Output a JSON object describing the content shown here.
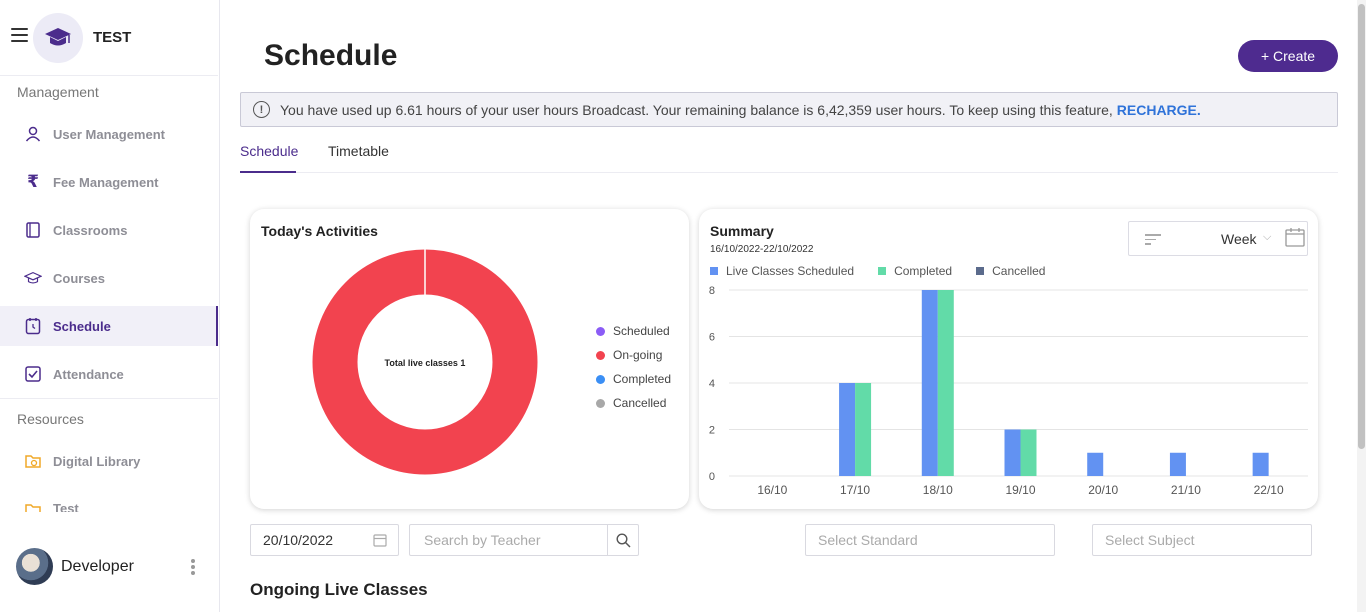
{
  "sidebar": {
    "brand": "TEST",
    "section_management": "Management",
    "section_resources": "Resources",
    "items": [
      {
        "label": "User Management",
        "icon": "user-icon"
      },
      {
        "label": "Fee Management",
        "icon": "rupee-icon"
      },
      {
        "label": "Classrooms",
        "icon": "book-icon"
      },
      {
        "label": "Courses",
        "icon": "graduation-cap-icon"
      },
      {
        "label": "Schedule",
        "icon": "clock-icon",
        "active": true
      },
      {
        "label": "Attendance",
        "icon": "checkbox-icon"
      }
    ],
    "resources": [
      {
        "label": "Digital Library",
        "icon": "library-icon"
      },
      {
        "label": "Test",
        "icon": "test-icon"
      }
    ],
    "user_name": "Developer"
  },
  "header": {
    "title": "Schedule",
    "create_label": "+ Create"
  },
  "alert": {
    "text": "You have used up 6.61 hours of your user hours Broadcast. Your remaining balance is 6,42,359 user hours. To keep using this feature,",
    "link": "RECHARGE."
  },
  "tabs": [
    "Schedule",
    "Timetable"
  ],
  "activities": {
    "title": "Today's Activities",
    "center_label": "Total live classes 1",
    "legend": [
      {
        "label": "Scheduled",
        "color": "#8b5cf6"
      },
      {
        "label": "On-going",
        "color": "#f2434f"
      },
      {
        "label": "Completed",
        "color": "#3b8ff5"
      },
      {
        "label": "Cancelled",
        "color": "#a8a8a8"
      }
    ]
  },
  "summary": {
    "title": "Summary",
    "range": "16/10/2022-22/10/2022",
    "period": "Week"
  },
  "chart_data": {
    "type": "bar",
    "categories": [
      "16/10",
      "17/10",
      "18/10",
      "19/10",
      "20/10",
      "21/10",
      "22/10"
    ],
    "series": [
      {
        "name": "Live Classes Scheduled",
        "color": "#6292f2",
        "values": [
          0,
          4,
          8,
          2,
          1,
          1,
          1
        ]
      },
      {
        "name": "Completed",
        "color": "#62dba8",
        "values": [
          0,
          4,
          8,
          2,
          0,
          0,
          0
        ]
      },
      {
        "name": "Cancelled",
        "color": "#5b6b8c",
        "values": [
          0,
          0,
          0,
          0,
          0,
          0,
          0
        ]
      }
    ],
    "yticks": [
      "0",
      "2",
      "4",
      "6",
      "8"
    ],
    "ylim": [
      0,
      8
    ],
    "grid": true,
    "legend": "top-left"
  },
  "filters": {
    "date": "20/10/2022",
    "teacher_placeholder": "Search by Teacher",
    "standard_placeholder": "Select Standard",
    "subject_placeholder": "Select Subject"
  },
  "ongoing_title": "Ongoing Live Classes"
}
